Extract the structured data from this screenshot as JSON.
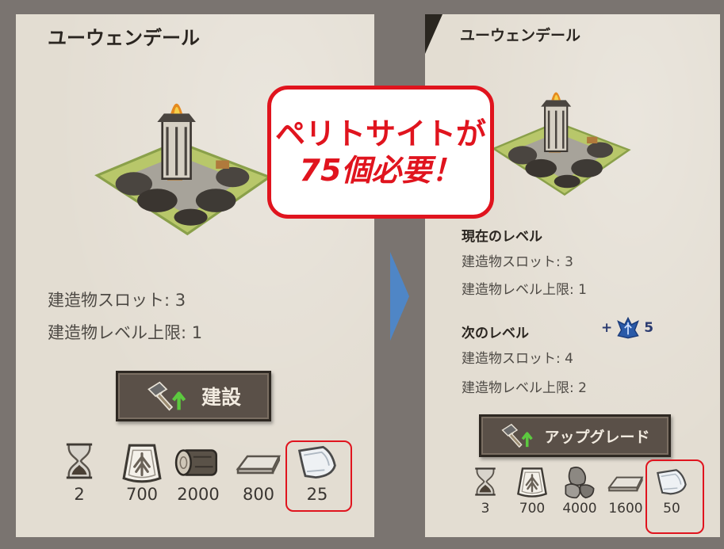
{
  "left": {
    "title": "ユーウェンデール",
    "stats": [
      "建造物スロット: 3",
      "建造物レベル上限: 1"
    ],
    "button_label": "建設",
    "resources": [
      {
        "icon": "hourglass-icon",
        "value": "2"
      },
      {
        "icon": "emblem-badge-icon",
        "value": "700"
      },
      {
        "icon": "log-icon",
        "value": "2000"
      },
      {
        "icon": "metal-ingot-icon",
        "value": "800"
      },
      {
        "icon": "peritite-icon",
        "value": "25"
      }
    ]
  },
  "right": {
    "title": "ユーウェンデール",
    "current_header": "現在のレベル",
    "current_stats": [
      "建造物スロット: 3",
      "建造物レベル上限: 1"
    ],
    "next_header": "次のレベル",
    "next_bonus_prefix": "+",
    "next_bonus_value": "5",
    "next_stats": [
      "建造物スロット: 4",
      "建造物レベル上限: 2"
    ],
    "button_label": "アップグレード",
    "resources": [
      {
        "icon": "hourglass-icon",
        "value": "3"
      },
      {
        "icon": "emblem-badge-icon",
        "value": "700"
      },
      {
        "icon": "stone-icon",
        "value": "4000"
      },
      {
        "icon": "metal-ingot-icon",
        "value": "1600"
      },
      {
        "icon": "peritite-icon",
        "value": "50"
      }
    ]
  },
  "callout": {
    "line1": "ペリトサイトが",
    "line2": "75個必要！"
  },
  "colors": {
    "highlight": "#e0141e",
    "arrow": "#4f86c6",
    "panel": "#e3ddd2",
    "background": "#7a7470",
    "button": "#5a5048"
  }
}
